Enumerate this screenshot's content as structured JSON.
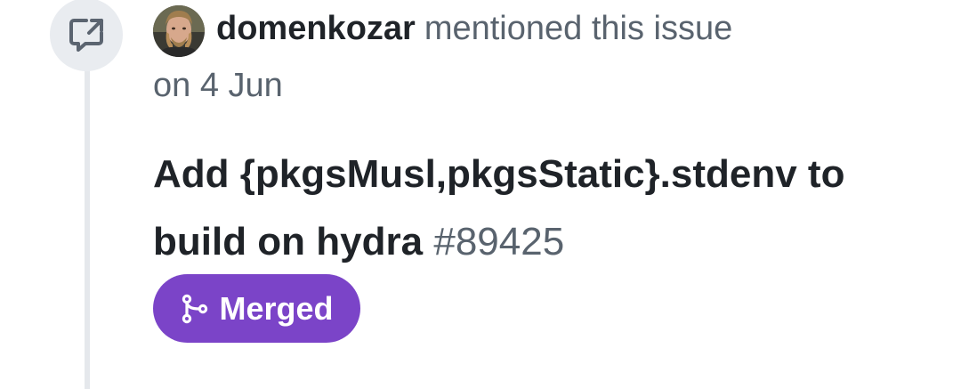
{
  "event": {
    "icon": "cross-reference-icon",
    "author": "domenkozar",
    "action": "mentioned this issue",
    "date": "on 4 Jun"
  },
  "issue": {
    "title": "Add {pkgsMusl,pkgsStatic}.stdenv to build on hydra",
    "number": "#89425"
  },
  "badge": {
    "label": "Merged",
    "icon": "git-merge-icon",
    "color": "#7b44c8"
  }
}
